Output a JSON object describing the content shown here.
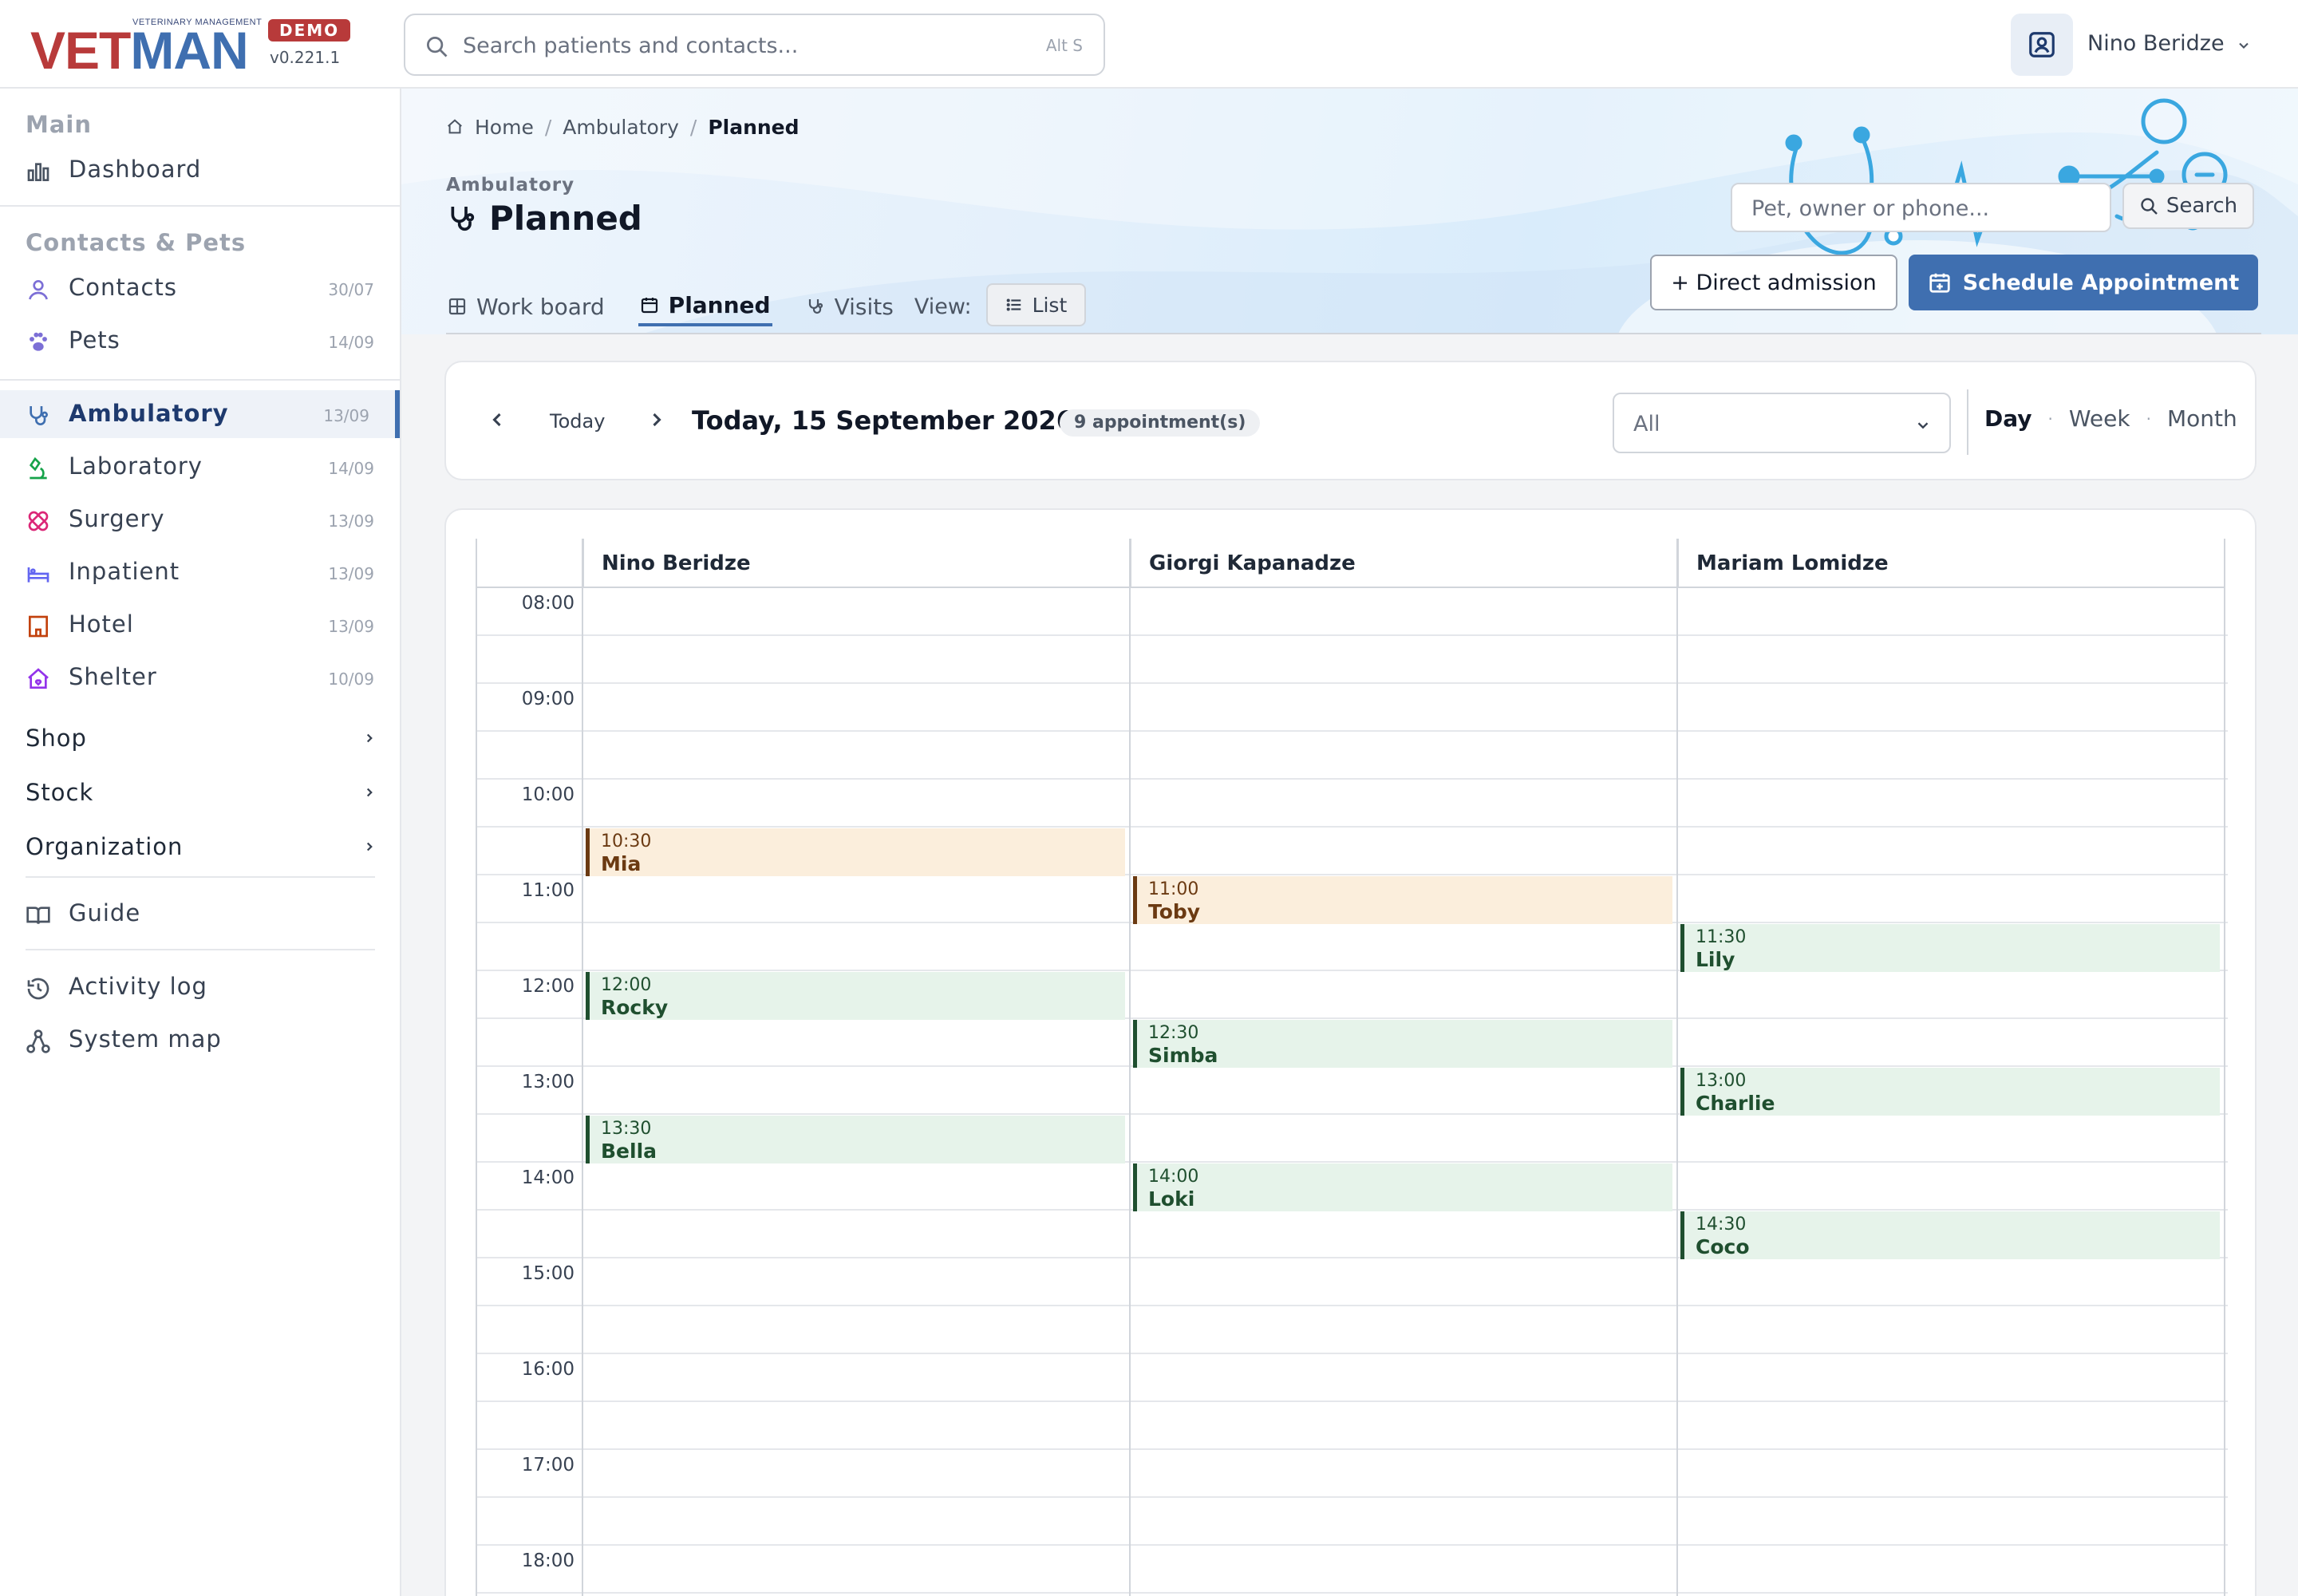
{
  "app": {
    "logo_sub": "VETERINARY MANAGEMENT",
    "logo_vet": "VET",
    "logo_man": "MAN",
    "badge": "DEMO",
    "version": "v0.221.1"
  },
  "search": {
    "placeholder": "Search patients and contacts...",
    "shortcut": "Alt S"
  },
  "user": {
    "name": "Nino Beridze"
  },
  "sidebar": {
    "main_title": "Main",
    "dashboard": "Dashboard",
    "contacts_title": "Contacts & Pets",
    "items": [
      {
        "label": "Contacts",
        "date": "30/07"
      },
      {
        "label": "Pets",
        "date": "14/09"
      },
      {
        "label": "Ambulatory",
        "date": "13/09"
      },
      {
        "label": "Laboratory",
        "date": "14/09"
      },
      {
        "label": "Surgery",
        "date": "13/09"
      },
      {
        "label": "Inpatient",
        "date": "13/09"
      },
      {
        "label": "Hotel",
        "date": "13/09"
      },
      {
        "label": "Shelter",
        "date": "10/09"
      }
    ],
    "groups": [
      "Shop",
      "Stock",
      "Organization"
    ],
    "guide": "Guide",
    "activity": "Activity log",
    "system_map": "System map"
  },
  "breadcrumb": {
    "home": "Home",
    "section": "Ambulatory",
    "current": "Planned"
  },
  "header": {
    "kicker": "Ambulatory",
    "title": "Planned",
    "search_placeholder": "Pet, owner or phone...",
    "search_btn": "Search",
    "direct_btn": "+ Direct admission",
    "schedule_btn": "Schedule Appointment"
  },
  "tabs": {
    "workboard": "Work board",
    "planned": "Planned",
    "visits": "Visits",
    "view_label": "View:",
    "list": "List"
  },
  "toolbar": {
    "today": "Today",
    "date": "Today, 15 September 2026",
    "count": "9 appointment(s)",
    "filter": "All",
    "day": "Day",
    "week": "Week",
    "month": "Month",
    "dot": "·"
  },
  "calendar": {
    "doctors": [
      "Nino Beridze",
      "Giorgi Kapanadze",
      "Mariam Lomidze"
    ],
    "times": [
      "08:00",
      "09:00",
      "10:00",
      "11:00",
      "12:00",
      "13:00",
      "14:00",
      "15:00",
      "16:00",
      "17:00",
      "18:00"
    ],
    "appointments": [
      {
        "doctor": 0,
        "time": "10:30",
        "pet": "Mia",
        "status": "orange"
      },
      {
        "doctor": 1,
        "time": "11:00",
        "pet": "Toby",
        "status": "orange"
      },
      {
        "doctor": 2,
        "time": "11:30",
        "pet": "Lily",
        "status": "green"
      },
      {
        "doctor": 0,
        "time": "12:00",
        "pet": "Rocky",
        "status": "green"
      },
      {
        "doctor": 1,
        "time": "12:30",
        "pet": "Simba",
        "status": "green"
      },
      {
        "doctor": 2,
        "time": "13:00",
        "pet": "Charlie",
        "status": "green"
      },
      {
        "doctor": 0,
        "time": "13:30",
        "pet": "Bella",
        "status": "green"
      },
      {
        "doctor": 1,
        "time": "14:00",
        "pet": "Loki",
        "status": "green"
      },
      {
        "doctor": 2,
        "time": "14:30",
        "pet": "Coco",
        "status": "green"
      }
    ]
  },
  "colors": {
    "brand": "#3f6fb0",
    "brand_red": "#b83a3a",
    "orange_bg": "#fbeedc",
    "green_bg": "#e6f3ea"
  }
}
